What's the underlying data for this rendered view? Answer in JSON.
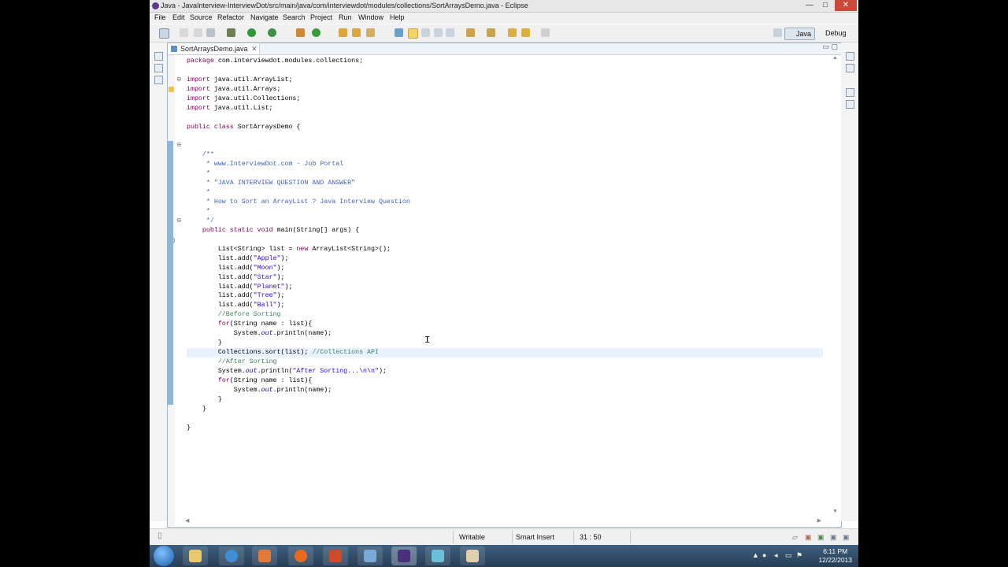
{
  "window": {
    "title": "Java - JavaInterview-InterviewDot/src/main/java/com/interviewdot/modules/collections/SortArraysDemo.java - Eclipse",
    "controls": [
      "—",
      "□",
      "✕"
    ]
  },
  "menu": [
    "File",
    "Edit",
    "Source",
    "Refactor",
    "Navigate",
    "Search",
    "Project",
    "Run",
    "Window",
    "Help"
  ],
  "perspectives": {
    "java": "Java",
    "debug": "Debug"
  },
  "editor": {
    "tab_label": "SortArraysDemo.java",
    "tab_close": "✕",
    "lines": [
      [
        [
          "kw",
          "package"
        ],
        [
          "t",
          " com.interviewdot.modules.collections;"
        ]
      ],
      [],
      [
        [
          "kw",
          "import"
        ],
        [
          "t",
          " java.util.ArrayList;"
        ]
      ],
      [
        [
          "kw",
          "import"
        ],
        [
          "t",
          " java.util.Arrays;"
        ]
      ],
      [
        [
          "kw",
          "import"
        ],
        [
          "t",
          " java.util.Collections;"
        ]
      ],
      [
        [
          "kw",
          "import"
        ],
        [
          "t",
          " java.util.List;"
        ]
      ],
      [],
      [
        [
          "kw",
          "public class"
        ],
        [
          "t",
          " SortArraysDemo {"
        ]
      ],
      [],
      [],
      [
        [
          "t",
          "    "
        ],
        [
          "jd",
          "/**"
        ]
      ],
      [
        [
          "jd",
          "     * www.InterviewDot.com - Job Portal"
        ]
      ],
      [
        [
          "jd",
          "     *"
        ]
      ],
      [
        [
          "jd",
          "     * \"JAVA INTERVIEW QUESTION AND ANSWER\""
        ]
      ],
      [
        [
          "jd",
          "     *"
        ]
      ],
      [
        [
          "jd",
          "     * How to Sort an ArrayList ? Java Interview Question"
        ]
      ],
      [
        [
          "jd",
          "     *"
        ]
      ],
      [
        [
          "jd",
          "     */"
        ]
      ],
      [
        [
          "t",
          "    "
        ],
        [
          "kw",
          "public static void"
        ],
        [
          "t",
          " main(String[] args) {"
        ]
      ],
      [],
      [
        [
          "t",
          "        List<String> list = "
        ],
        [
          "kw",
          "new"
        ],
        [
          "t",
          " ArrayList<String>();"
        ]
      ],
      [
        [
          "t",
          "        list.add("
        ],
        [
          "str",
          "\"Apple\""
        ],
        [
          "t",
          ");"
        ]
      ],
      [
        [
          "t",
          "        list.add("
        ],
        [
          "str",
          "\"Moon\""
        ],
        [
          "t",
          ");"
        ]
      ],
      [
        [
          "t",
          "        list.add("
        ],
        [
          "str",
          "\"Star\""
        ],
        [
          "t",
          ");"
        ]
      ],
      [
        [
          "t",
          "        list.add("
        ],
        [
          "str",
          "\"Planet\""
        ],
        [
          "t",
          ");"
        ]
      ],
      [
        [
          "t",
          "        list.add("
        ],
        [
          "str",
          "\"Tree\""
        ],
        [
          "t",
          ");"
        ]
      ],
      [
        [
          "t",
          "        list.add("
        ],
        [
          "str",
          "\"Ball\""
        ],
        [
          "t",
          ");"
        ]
      ],
      [
        [
          "t",
          "        "
        ],
        [
          "cm",
          "//Before Sorting"
        ]
      ],
      [
        [
          "t",
          "        "
        ],
        [
          "kw",
          "for"
        ],
        [
          "t",
          "(String name : list){"
        ]
      ],
      [
        [
          "t",
          "            System."
        ],
        [
          "fld",
          "out"
        ],
        [
          "t",
          ".println(name);"
        ]
      ],
      [
        [
          "t",
          "        }"
        ]
      ],
      [
        [
          "t",
          "        Collections.sort(list); "
        ],
        [
          "cm",
          "//Collections API"
        ]
      ],
      [
        [
          "t",
          "        "
        ],
        [
          "cm",
          "//After Sorting"
        ]
      ],
      [
        [
          "t",
          "        System."
        ],
        [
          "fld",
          "out"
        ],
        [
          "t",
          ".println("
        ],
        [
          "str",
          "\"After Sorting...\\n\\n\""
        ],
        [
          "t",
          ");"
        ]
      ],
      [
        [
          "t",
          "        "
        ],
        [
          "kw",
          "for"
        ],
        [
          "t",
          "(String name : list){"
        ]
      ],
      [
        [
          "t",
          "            System."
        ],
        [
          "fld",
          "out"
        ],
        [
          "t",
          ".println(name);"
        ]
      ],
      [
        [
          "t",
          "        }"
        ]
      ],
      [
        [
          "t",
          "    }"
        ]
      ],
      [],
      [
        [
          "t",
          "}"
        ]
      ]
    ],
    "current_line": 32
  },
  "status": {
    "writable": "Writable",
    "insert_mode": "Smart Insert",
    "position": "31 : 50"
  },
  "taskbar": {
    "time": "6:11 PM",
    "date": "12/22/2013"
  },
  "colors": {
    "keyword": "#7f0055",
    "string": "#2a00ff",
    "comment": "#3f7f5f",
    "javadoc": "#3f5fbf",
    "field": "#0000c0"
  }
}
